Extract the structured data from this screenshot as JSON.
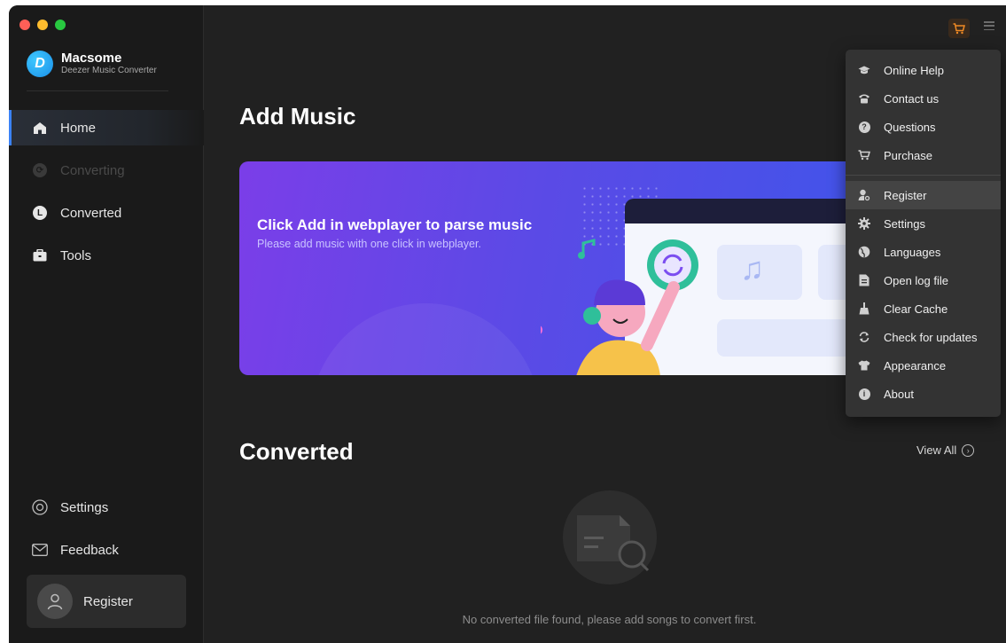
{
  "app": {
    "name": "Macsome",
    "subtitle": "Deezer Music Converter",
    "logo_letter": "D"
  },
  "sidebar": {
    "items": [
      {
        "label": "Home",
        "icon": "home-icon",
        "active": true
      },
      {
        "label": "Converting",
        "icon": "converting-icon",
        "disabled": true
      },
      {
        "label": "Converted",
        "icon": "clock-icon"
      },
      {
        "label": "Tools",
        "icon": "toolbox-icon"
      }
    ],
    "bottom_items": [
      {
        "label": "Settings",
        "icon": "settings-icon"
      },
      {
        "label": "Feedback",
        "icon": "mail-icon"
      }
    ],
    "register_label": "Register"
  },
  "main": {
    "add_music_title": "Add Music",
    "banner": {
      "title": "Click Add in webplayer to parse music",
      "subtitle": "Please add music with one click in webplayer."
    },
    "converted_title": "Converted",
    "view_all": "View All",
    "empty_message": "No converted file found, please add songs to convert first."
  },
  "menu": {
    "items": [
      {
        "label": "Online Help",
        "icon": "graduation-cap-icon"
      },
      {
        "label": "Contact us",
        "icon": "phone-icon"
      },
      {
        "label": "Questions",
        "icon": "question-icon"
      },
      {
        "label": "Purchase",
        "icon": "cart-icon"
      },
      {
        "label": "Register",
        "icon": "user-key-icon",
        "hover": true
      },
      {
        "label": "Settings",
        "icon": "gear-icon"
      },
      {
        "label": "Languages",
        "icon": "globe-icon"
      },
      {
        "label": "Open log file",
        "icon": "file-icon"
      },
      {
        "label": "Clear Cache",
        "icon": "broom-icon"
      },
      {
        "label": "Check for updates",
        "icon": "refresh-icon"
      },
      {
        "label": "Appearance",
        "icon": "shirt-icon"
      },
      {
        "label": "About",
        "icon": "info-icon"
      }
    ]
  },
  "colors": {
    "accent": "#3b82f6",
    "cart": "#f08a24",
    "background": "#212121",
    "sidebar": "#1a1a1a",
    "menu": "#333333"
  }
}
